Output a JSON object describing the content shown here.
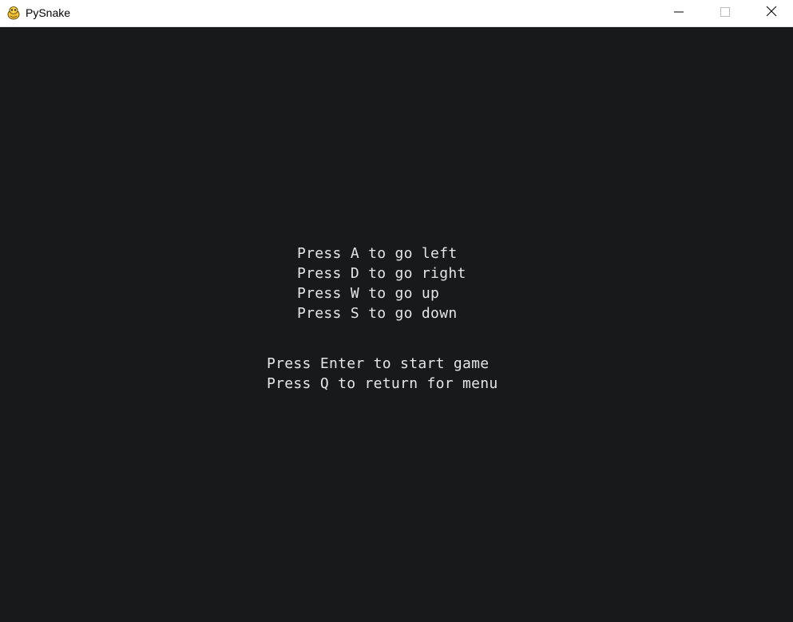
{
  "window": {
    "title": "PySnake",
    "app_icon": "pygame-snake-icon",
    "controls": {
      "minimize_icon": "minimize-icon",
      "maximize_icon": "maximize-icon",
      "close_icon": "close-icon"
    }
  },
  "instructions": {
    "controls": [
      "Press A to go left",
      "Press D to go right",
      "Press W to go up",
      "Press S to go down"
    ],
    "start": "Press Enter to start game",
    "menu": "Press Q to return for menu"
  },
  "colors": {
    "background": "#18191b",
    "text": "#e6e6e6",
    "titlebar": "#ffffff"
  }
}
